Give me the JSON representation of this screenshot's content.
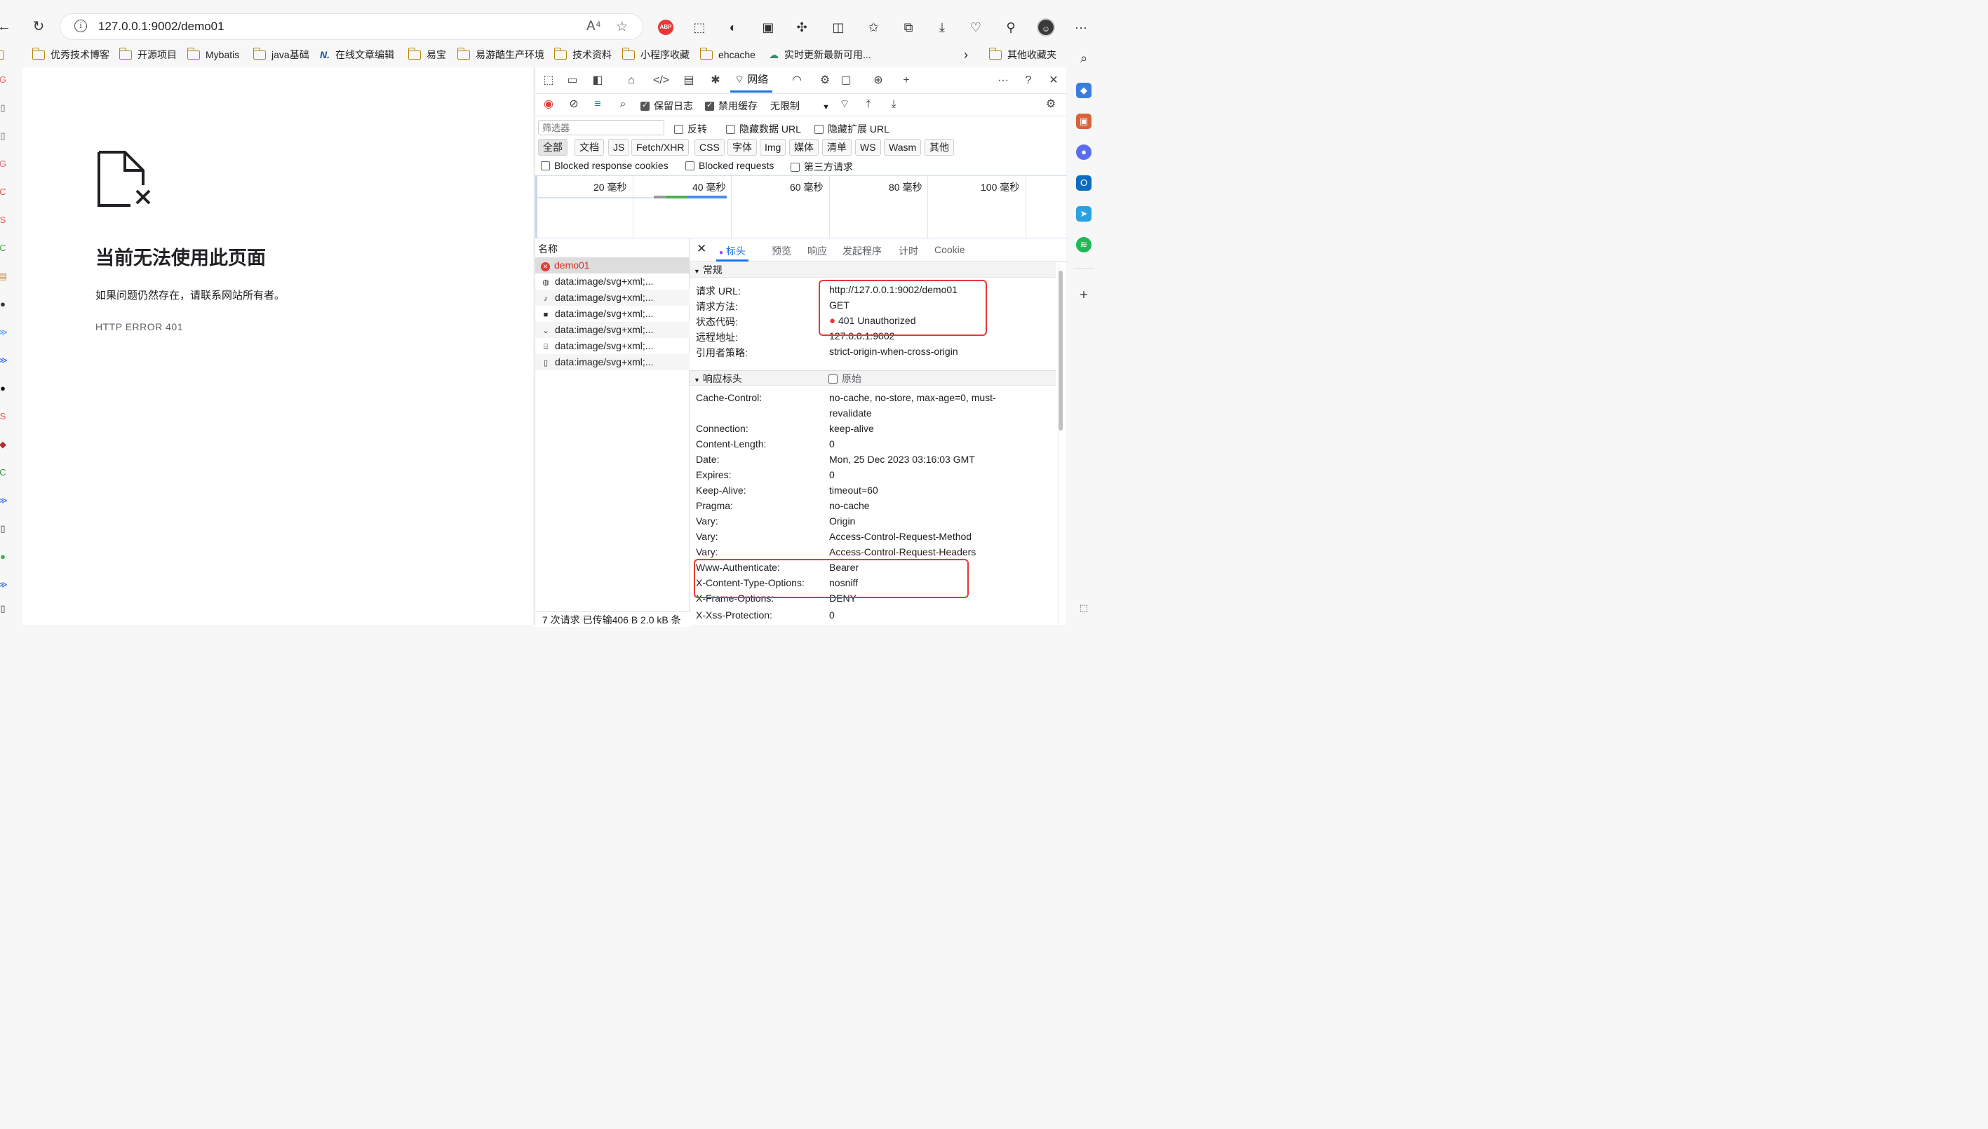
{
  "address_bar": {
    "url": "127.0.0.1:9002/demo01",
    "read_aloud_glyph": "A⁴",
    "toolbar_icons": [
      "adblock-plus-icon",
      "screen-capture-icon",
      "mouse-icon",
      "z-extension-icon",
      "extensions-icon",
      "split-screen-icon",
      "favorites-icon",
      "collections-icon",
      "download-icon",
      "health-icon",
      "sync-icon",
      "profile-avatar",
      "more-icon"
    ],
    "abp_label": "ABP",
    "more_label": "···"
  },
  "bookmarks": [
    {
      "label": "优秀技术博客",
      "type": "folder"
    },
    {
      "label": "开源项目",
      "type": "folder"
    },
    {
      "label": "Mybatis",
      "type": "folder"
    },
    {
      "label": "java基础",
      "type": "folder"
    },
    {
      "label": "在线文章编辑",
      "type": "link"
    },
    {
      "label": "易宝",
      "type": "folder"
    },
    {
      "label": "易游酷生产环境",
      "type": "folder"
    },
    {
      "label": "技术资料",
      "type": "folder"
    },
    {
      "label": "小程序收藏",
      "type": "folder"
    },
    {
      "label": "ehcache",
      "type": "folder"
    },
    {
      "label": "实时更新最新可用...",
      "type": "link"
    },
    {
      "label": "其他收藏夹",
      "type": "folder"
    }
  ],
  "error_page": {
    "title": "当前无法使用此页面",
    "message": "如果问题仍然存在，请联系网站所有者。",
    "code": "HTTP ERROR 401"
  },
  "devtools": {
    "network_tab_label": "网络",
    "toolbar": {
      "preserve_log": "保留日志",
      "disable_cache": "禁用缓存",
      "throttle": "无限制"
    },
    "filter": {
      "placeholder": "筛选器",
      "invert": "反转",
      "hide_data_urls": "隐藏数据 URL",
      "hide_extension_urls": "隐藏扩展 URL"
    },
    "types": [
      "全部",
      "文档",
      "JS",
      "Fetch/XHR",
      "CSS",
      "字体",
      "Img",
      "媒体",
      "清单",
      "WS",
      "Wasm",
      "其他"
    ],
    "blocked": {
      "blocked_cookies": "Blocked response cookies",
      "blocked_requests": "Blocked requests",
      "third_party": "第三方请求"
    },
    "timeline_ticks": [
      "20 毫秒",
      "40 毫秒",
      "60 毫秒",
      "80 毫秒",
      "100 毫秒"
    ],
    "request_list": {
      "header": "名称",
      "rows": [
        {
          "name": "demo01",
          "status": "error"
        },
        {
          "name": "data:image/svg+xml;...",
          "status": "ok"
        },
        {
          "name": "data:image/svg+xml;...",
          "status": "ok"
        },
        {
          "name": "data:image/svg+xml;...",
          "status": "ok"
        },
        {
          "name": "data:image/svg+xml;...",
          "status": "ok"
        },
        {
          "name": "data:image/svg+xml;...",
          "status": "ok"
        },
        {
          "name": "data:image/svg+xml;...",
          "status": "ok"
        }
      ],
      "footer": "7 次请求  已传输406 B  2.0 kB 条"
    },
    "detail_tabs": [
      "标头",
      "预览",
      "响应",
      "发起程序",
      "计时",
      "Cookie"
    ],
    "general": {
      "title": "常规",
      "rows": [
        {
          "k": "请求 URL:",
          "v": "http://127.0.0.1:9002/demo01"
        },
        {
          "k": "请求方法:",
          "v": "GET"
        },
        {
          "k": "状态代码:",
          "v": "401 Unauthorized"
        },
        {
          "k": "远程地址:",
          "v": "127.0.0.1:9002"
        },
        {
          "k": "引用者策略:",
          "v": "strict-origin-when-cross-origin"
        }
      ]
    },
    "response_headers": {
      "title": "响应标头",
      "raw_label": "原始",
      "rows": [
        {
          "k": "Cache-Control:",
          "v": "no-cache, no-store, max-age=0, must-",
          "v2": "revalidate"
        },
        {
          "k": "Connection:",
          "v": "keep-alive"
        },
        {
          "k": "Content-Length:",
          "v": "0"
        },
        {
          "k": "Date:",
          "v": "Mon, 25 Dec 2023 03:16:03 GMT"
        },
        {
          "k": "Expires:",
          "v": "0"
        },
        {
          "k": "Keep-Alive:",
          "v": "timeout=60"
        },
        {
          "k": "Pragma:",
          "v": "no-cache"
        },
        {
          "k": "Vary:",
          "v": "Origin"
        },
        {
          "k": "Vary:",
          "v": "Access-Control-Request-Method"
        },
        {
          "k": "Vary:",
          "v": "Access-Control-Request-Headers"
        },
        {
          "k": "Www-Authenticate:",
          "v": "Bearer"
        },
        {
          "k": "X-Content-Type-Options:",
          "v": "nosniff"
        },
        {
          "k": "X-Frame-Options:",
          "v": "DENY"
        },
        {
          "k": "X-Xss-Protection:",
          "v": "0"
        }
      ]
    }
  },
  "colors": {
    "error_red": "#e53935",
    "accent_blue": "#1a73e8",
    "tab_dot": "#8e44ff"
  }
}
